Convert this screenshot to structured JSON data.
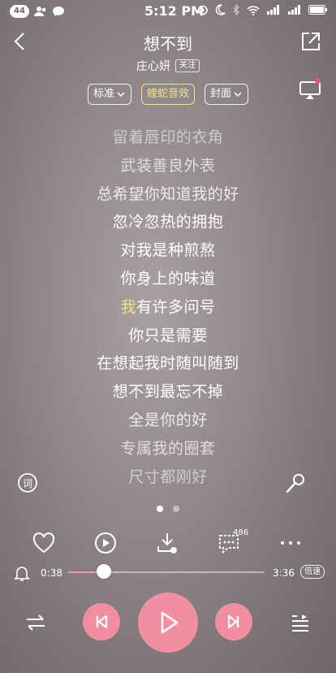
{
  "status_bar": {
    "badge": "44",
    "time": "5:12 PM",
    "icons": [
      "user-icon",
      "chat-bubble-icon",
      "alarm-icon",
      "moon-icon",
      "bluetooth-icon",
      "wifi-icon",
      "signal-icon",
      "signal-icon",
      "battery-icon"
    ]
  },
  "header": {
    "title": "想不到",
    "artist": "庄心妍",
    "follow_label": "关注"
  },
  "chips": [
    {
      "label": "标准",
      "dropdown": true
    },
    {
      "label": "蝰蛇音效",
      "dropdown": false
    },
    {
      "label": "封面",
      "dropdown": true
    }
  ],
  "lyrics": [
    "留着唇印的衣角",
    "武装善良外表",
    "总希望你知道我的好",
    "忽冷忽热的拥抱",
    "对我是种煎熬",
    "你身上的味道",
    "有许多问号",
    "你只是需要",
    "在想起我时随叫随到",
    "想不到最忘不掉",
    "全是你的好",
    "专属我的圈套",
    "尺寸都刚好"
  ],
  "current_line": {
    "highlight": "我"
  },
  "page_dots": {
    "count": 2,
    "active": 1
  },
  "actions": {
    "comment_count": "486"
  },
  "progress": {
    "current": "0:38",
    "total": "3:36",
    "fraction": 0.18,
    "speed_label": "倍速"
  },
  "colors": {
    "accent": "#f28ea1",
    "highlight": "#f3e28a"
  }
}
